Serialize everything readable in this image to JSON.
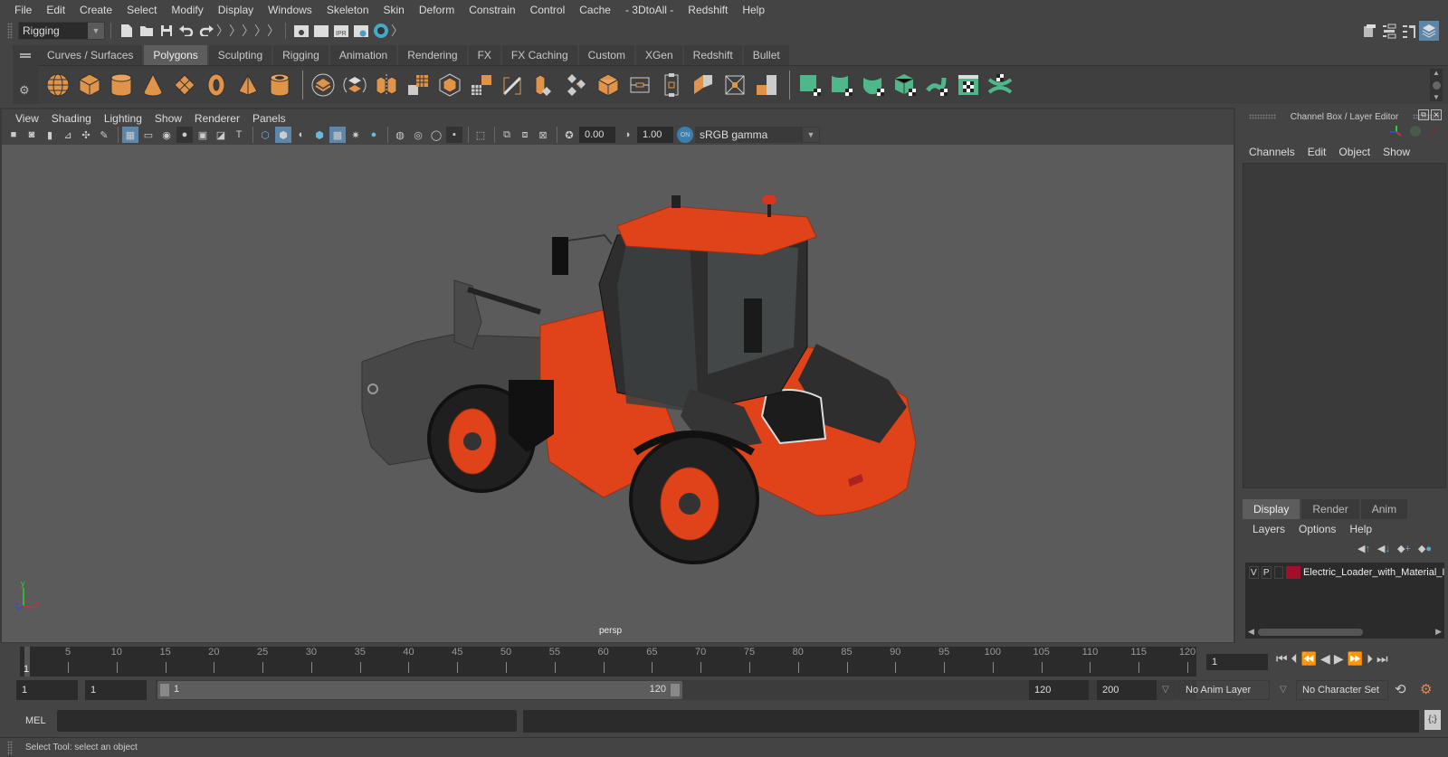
{
  "menubar": {
    "items": [
      "File",
      "Edit",
      "Create",
      "Select",
      "Modify",
      "Display",
      "Windows",
      "Skeleton",
      "Skin",
      "Deform",
      "Constrain",
      "Control",
      "Cache",
      "- 3DtoAll -",
      "Redshift",
      "Help"
    ]
  },
  "statusline": {
    "menuset": "Rigging",
    "icons": [
      "new-scene-icon",
      "open-scene-icon",
      "save-scene-icon",
      "undo-icon",
      "redo-icon",
      "render-view-icon",
      "render-frame-icon",
      "ipr-render-icon",
      "render-settings-icon",
      "hypershade-icon"
    ]
  },
  "shelf": {
    "tabs": [
      "Curves / Surfaces",
      "Polygons",
      "Sculpting",
      "Rigging",
      "Animation",
      "Rendering",
      "FX",
      "FX Caching",
      "Custom",
      "XGen",
      "Redshift",
      "Bullet"
    ],
    "active_tab": "Polygons",
    "icons_group1": [
      "poly-sphere-icon",
      "poly-cube-icon",
      "poly-cylinder-icon",
      "poly-cone-icon",
      "poly-plane-icon",
      "poly-torus-icon",
      "poly-pyramid-icon",
      "poly-pipe-icon"
    ],
    "icons_group2": [
      "combine-icon",
      "separate-icon",
      "mirror-icon",
      "smooth-icon",
      "bevel-icon",
      "bridge-icon",
      "extrude-icon",
      "multicut-icon",
      "target-weld-icon",
      "append-icon",
      "fill-hole-icon",
      "center-pivot-icon",
      "freeze-icon",
      "delete-history-icon",
      "quad-draw-icon"
    ],
    "icons_group3": [
      "planar-uv-icon",
      "cylindrical-uv-icon",
      "spherical-uv-icon",
      "automatic-uv-icon",
      "unfold-uv-icon",
      "uv-editor-icon",
      "cut-uv-icon"
    ]
  },
  "viewport": {
    "menus": [
      "View",
      "Shading",
      "Lighting",
      "Show",
      "Renderer",
      "Panels"
    ],
    "exposure": "0.00",
    "gamma": "1.00",
    "color_space": "sRGB gamma",
    "camera_label": "persp",
    "axis": {
      "x": "x",
      "y": "y",
      "z": "z"
    },
    "colors": {
      "loader_body": "#e0431a",
      "loader_dark": "#2a2a2a",
      "loader_arm": "#474747"
    }
  },
  "channel_box": {
    "title": "Channel Box / Layer Editor",
    "menus": [
      "Channels",
      "Edit",
      "Object",
      "Show"
    ]
  },
  "layer_editor": {
    "tabs": [
      "Display",
      "Render",
      "Anim"
    ],
    "active_tab": "Display",
    "menus": [
      "Layers",
      "Options",
      "Help"
    ],
    "layers": [
      {
        "visible": "V",
        "playback": "P",
        "color": "#a0102a",
        "name": "Electric_Loader_with_Material_I"
      }
    ]
  },
  "timeline": {
    "ticks": [
      5,
      10,
      15,
      20,
      25,
      30,
      35,
      40,
      45,
      50,
      55,
      60,
      65,
      70,
      75,
      80,
      85,
      90,
      95,
      100,
      105,
      110,
      115,
      120
    ],
    "min": 1,
    "max": 120,
    "current_frame_marker": "1",
    "current_frame": "1"
  },
  "range": {
    "start": "1",
    "playback_start": "1",
    "slider_start": "1",
    "slider_end": "120",
    "playback_end": "120",
    "end": "200",
    "anim_layer": "No Anim Layer",
    "character_set": "No Character Set"
  },
  "command_line": {
    "label": "MEL",
    "value": "",
    "result": ""
  },
  "help_line": {
    "text": "Select Tool: select an object"
  }
}
